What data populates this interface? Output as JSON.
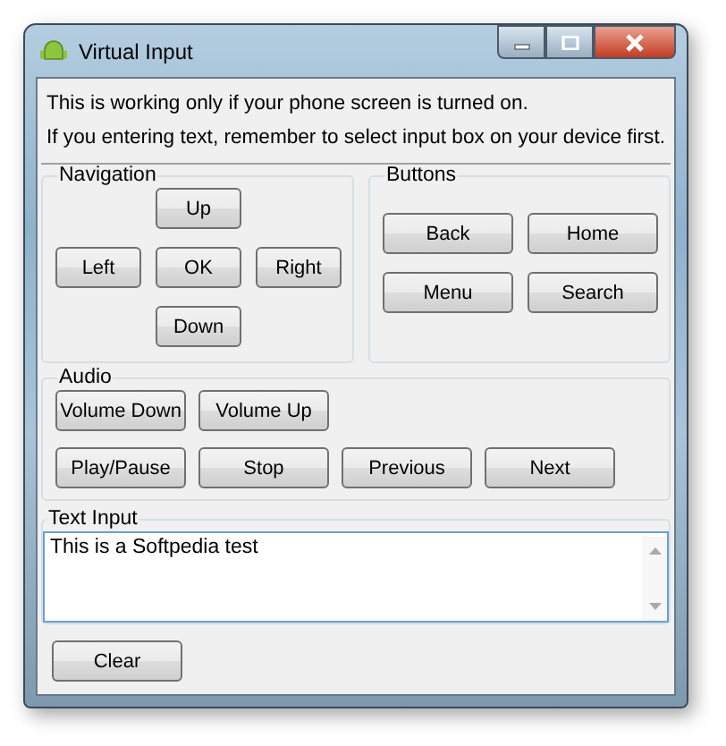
{
  "window": {
    "title": "Virtual Input"
  },
  "info": [
    "This is working only if your phone screen is turned on.",
    "If you entering text, remember to select input box on your device first."
  ],
  "navigation": {
    "title": "Navigation",
    "buttons": [
      {
        "label": "Up",
        "kind": "up"
      },
      {
        "label": "Left",
        "kind": "left"
      },
      {
        "label": "OK",
        "kind": "ok"
      },
      {
        "label": "Right",
        "kind": "right"
      },
      {
        "label": "Down",
        "kind": "down"
      }
    ]
  },
  "buttons": {
    "title": "Buttons",
    "items": [
      "Back",
      "Home",
      "Menu",
      "Search"
    ]
  },
  "audio": {
    "title": "Audio",
    "rows": [
      [
        "Volume Down",
        "Volume Up"
      ],
      [
        "Play/Pause",
        "Stop",
        "Previous",
        "Next"
      ]
    ]
  },
  "text_input": {
    "title": "Text Input",
    "value": "This is a Softpedia test"
  },
  "clear_button": "Clear"
}
